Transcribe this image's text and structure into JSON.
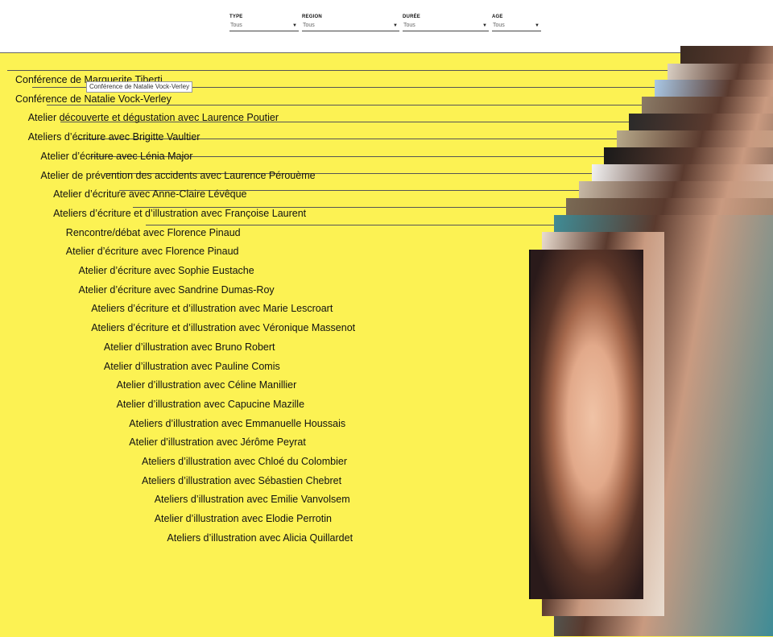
{
  "filters": [
    {
      "label": "TYPE",
      "value": "Tous"
    },
    {
      "label": "REGION",
      "value": "Tous"
    },
    {
      "label": "DURÉE",
      "value": "Tous"
    },
    {
      "label": "AGE",
      "value": "Tous"
    }
  ],
  "tooltip": "Conférence de Natalie Vock-Verley",
  "events": [
    "Conférence de Marguerite Tiberti",
    "Conférence de Natalie Vock-Verley",
    "Atelier découverte et dégustation avec Laurence Poutier",
    "Ateliers d’écriture avec Brigitte Vaultier",
    "Atelier d’écriture avec Lénia Major",
    "Atelier de prévention des accidents avec Laurence Pérouème",
    "Atelier d’écriture avec Anne-Claire Lévêque",
    "Ateliers d’écriture et d’illustration avec Françoise Laurent",
    "Rencontre/débat avec Florence Pinaud",
    "Atelier d’écriture avec Florence Pinaud",
    "Atelier d’écriture avec Sophie Eustache",
    "Atelier d’écriture avec Sandrine Dumas-Roy",
    "Ateliers d’écriture et d’illustration avec Marie Lescroart",
    "Ateliers d’écriture et d’illustration avec Véronique Massenot",
    "Atelier d’illustration avec Bruno Robert",
    "Atelier d’illustration avec Pauline Comis",
    "Atelier d’illustration avec Céline Manillier",
    "Atelier d’illustration avec Capucine Mazille",
    "Ateliers d’illustration avec Emmanuelle Houssais",
    "Atelier d’illustration avec Jérôme Peyrat",
    "Ateliers d’illustration avec Chloé du Colombier",
    "Ateliers d’illustration avec Sébastien Chebret",
    "Ateliers d’illustration avec Emilie Vanvolsem",
    "Atelier d’illustration avec Elodie Perrotin",
    "Ateliers d’illustration avec Alicia Quillardet"
  ],
  "colors": {
    "background": "#fcf253",
    "photo_tones": [
      "#3b2b22",
      "#d9cfc4",
      "#a9c8e6",
      "#8a7a66",
      "#2a2a2a",
      "#b7a98a",
      "#1a1a1a",
      "#f2f2f2",
      "#c7b9a6",
      "#7a6a55",
      "#3f8c96",
      "#e9dccf",
      "#b8583f"
    ]
  }
}
